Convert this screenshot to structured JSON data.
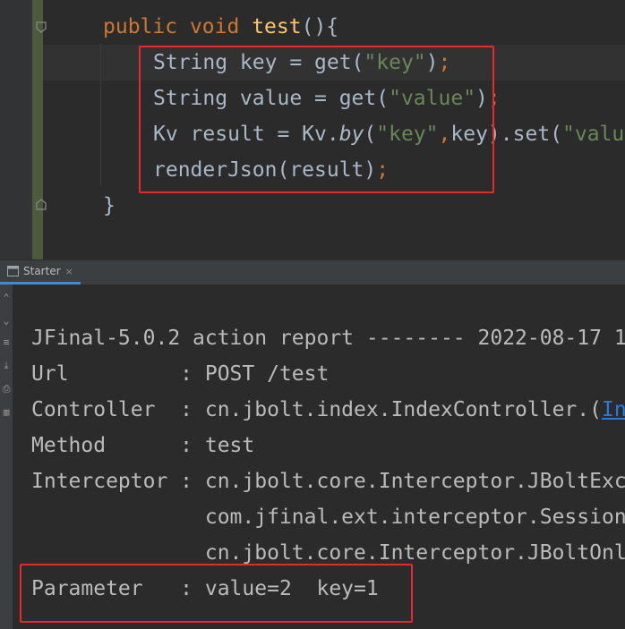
{
  "editor": {
    "lines": [
      {
        "kw1": "public",
        "kw2": "void",
        "fn": "test",
        "rest": "(){"
      },
      {
        "a": "String key = get(",
        "s": "\"key\"",
        "b": ")",
        "semi": ";"
      },
      {
        "a": "String value = get(",
        "s": "\"value\"",
        "b": ")",
        "semi": ";"
      },
      {
        "a": "Kv result = Kv.",
        "it": "by",
        "b": "(",
        "s1": "\"key\"",
        "comma": ",",
        "c": "key).set(",
        "s2": "\"valu"
      },
      {
        "a": "renderJson(result)",
        "semi": ";"
      },
      {
        "a": "}"
      }
    ]
  },
  "panel": {
    "tab_label": "Starter",
    "tab_close": "×"
  },
  "console": {
    "header": "JFinal-5.0.2 action report -------- 2022-08-17 1",
    "url": "Url         : POST /test",
    "controller_prefix": "Controller  : cn.jbolt.index.IndexController.(",
    "controller_link": "In",
    "method": "Method      : test",
    "interceptor1": "Interceptor : cn.jbolt.core.Interceptor.JBoltExc",
    "interceptor2": "              com.jfinal.ext.interceptor.Session",
    "interceptor3": "              cn.jbolt.core.Interceptor.JBoltOnl",
    "parameter": "Parameter   : value=2  key=1",
    "dashes": "-------------------------------------------------------"
  },
  "colors": {
    "keyword": "#cc7832",
    "function": "#ffc66d",
    "string": "#6a8759",
    "highlight_box": "#e62a2a",
    "link": "#287bde"
  }
}
